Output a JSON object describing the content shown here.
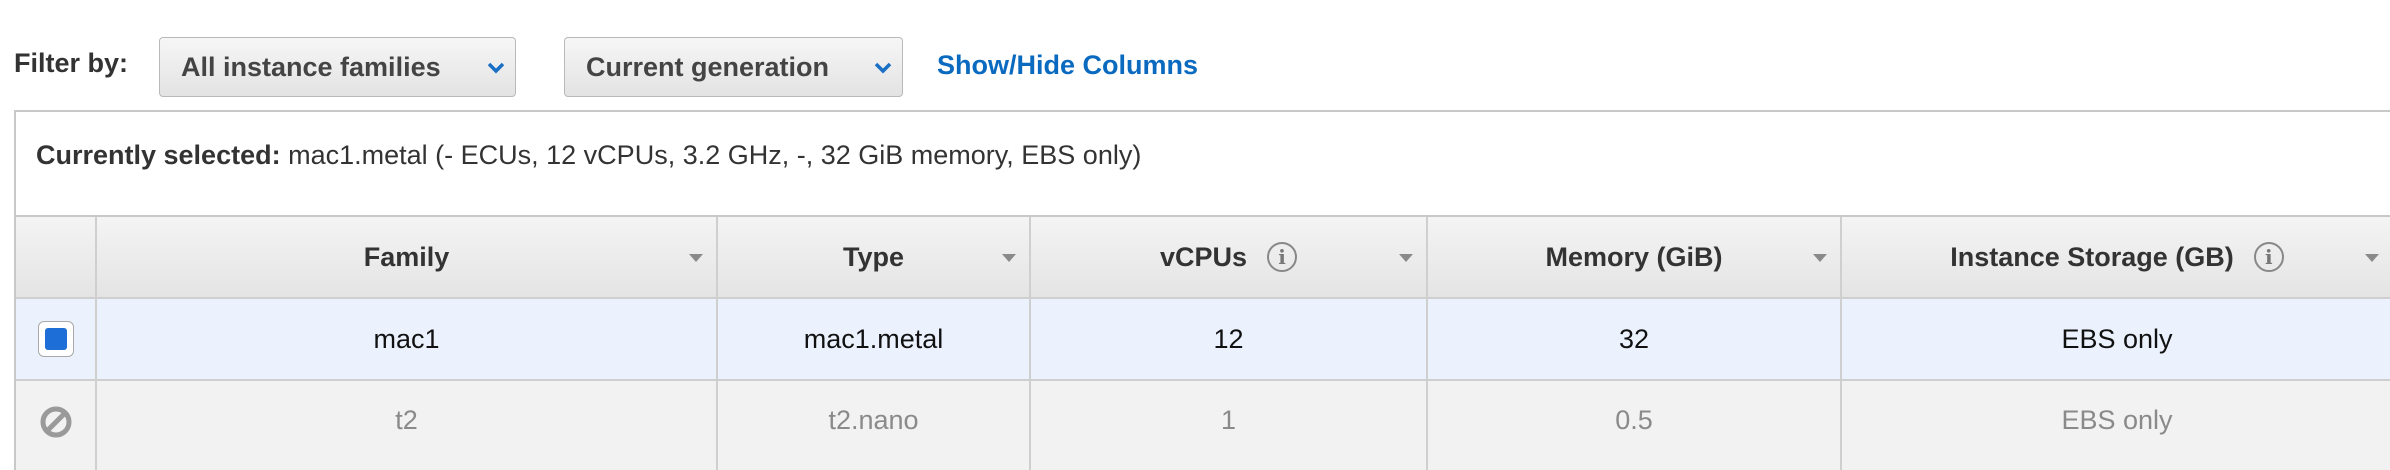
{
  "filter": {
    "label": "Filter by:",
    "family_select": {
      "value": "All instance families"
    },
    "generation_select": {
      "value": "Current generation"
    },
    "show_hide_link": "Show/Hide Columns"
  },
  "selection": {
    "label": "Currently selected:",
    "value": "mac1.metal (- ECUs, 12 vCPUs, 3.2 GHz, -, 32 GiB memory, EBS only)"
  },
  "table": {
    "columns": [
      {
        "label": "Family"
      },
      {
        "label": "Type"
      },
      {
        "label": "vCPUs",
        "info": true
      },
      {
        "label": "Memory (GiB)"
      },
      {
        "label": "Instance Storage (GB)",
        "info": true
      }
    ],
    "rows": [
      {
        "selected": true,
        "state": "selected",
        "family": "mac1",
        "type": "mac1.metal",
        "vcpus": "12",
        "memory": "32",
        "storage": "EBS only"
      },
      {
        "selected": false,
        "state": "disabled",
        "family": "t2",
        "type": "t2.nano",
        "vcpus": "1",
        "memory": "0.5",
        "storage": "EBS only"
      }
    ]
  },
  "icons": {
    "info": "i"
  },
  "colors": {
    "link": "#0a6abf",
    "selected_row_bg": "#ebf2fd",
    "checkbox_fill": "#1e6ed8",
    "disabled_text": "#8a8a8a"
  }
}
